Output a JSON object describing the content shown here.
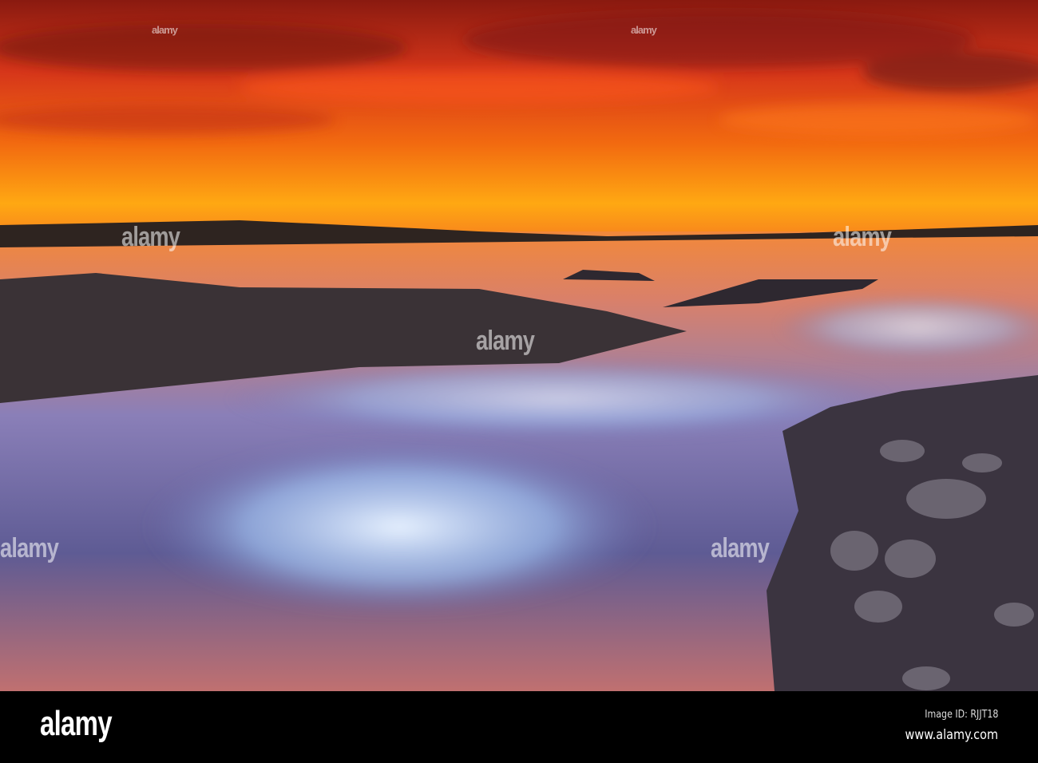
{
  "photo": {
    "subject": "sunset over rocky seashore with motion-blurred surf"
  },
  "watermark": "alamy",
  "footer": {
    "logo": "alamy",
    "image_id": "Image ID: RJJT18",
    "url": "www.alamy.com"
  },
  "colors": {
    "sky_top": "#b3200e",
    "sky_band": "#ff9a10",
    "water": "#6a6fa8",
    "rocks": "#3a3238",
    "footer": "#000000"
  }
}
